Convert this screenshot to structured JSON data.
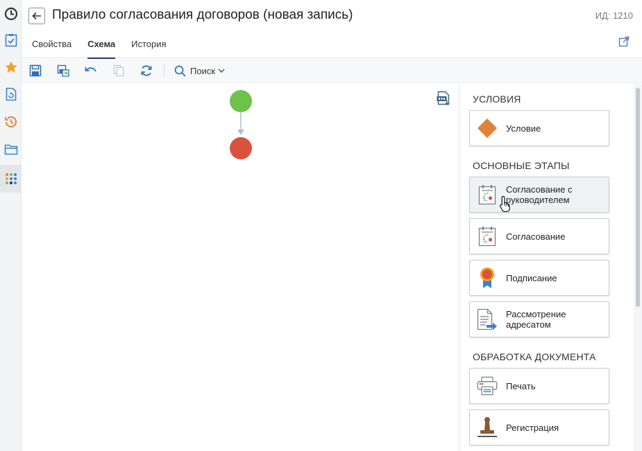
{
  "header": {
    "title": "Правило согласования договоров (новая запись)",
    "record_id": "ИД: 1210"
  },
  "tabs": [
    {
      "label": "Свойства",
      "active": false
    },
    {
      "label": "Схема",
      "active": true
    },
    {
      "label": "История",
      "active": false
    }
  ],
  "toolbar": {
    "search_label": "Поиск"
  },
  "rail": {
    "items": [
      "clock-icon",
      "tasks-icon",
      "favorites-icon",
      "documents-icon",
      "history-icon",
      "folder-icon",
      "apps-icon"
    ],
    "active": "apps-icon"
  },
  "panel": {
    "sections": [
      {
        "title": "УСЛОВИЯ",
        "items": [
          {
            "label": "Условие",
            "icon": "diamond-icon"
          }
        ]
      },
      {
        "title": "ОСНОВНЫЕ ЭТАПЫ",
        "items": [
          {
            "label": "Согласование с руководителем",
            "icon": "approval-icon",
            "hover": true
          },
          {
            "label": "Согласование",
            "icon": "approval-icon"
          },
          {
            "label": "Подписание",
            "icon": "signature-ribbon-icon"
          },
          {
            "label": "Рассмотрение адресатом",
            "icon": "document-forward-icon"
          }
        ]
      },
      {
        "title": "ОБРАБОТКА ДОКУМЕНТА",
        "items": [
          {
            "label": "Печать",
            "icon": "printer-icon"
          },
          {
            "label": "Регистрация",
            "icon": "stamp-icon"
          }
        ]
      }
    ]
  },
  "colors": {
    "start_node": "#6cc24a",
    "end_node": "#d9533a",
    "accent": "#1f3b64",
    "condition": "#e0823a"
  }
}
